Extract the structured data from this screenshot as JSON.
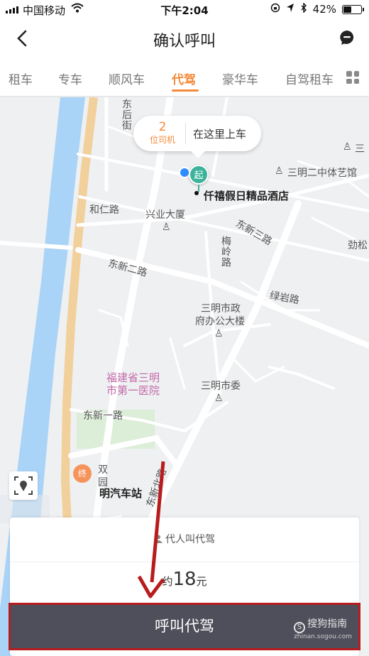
{
  "status_bar": {
    "carrier": "中国移动",
    "time": "下午2:04",
    "battery": "42%"
  },
  "nav": {
    "title": "确认呼叫"
  },
  "tabs": [
    "租车",
    "专车",
    "顺风车",
    "代驾",
    "豪华车",
    "自驾租车"
  ],
  "active_tab": "代驾",
  "map": {
    "bubble": {
      "driver_count": "2",
      "driver_unit": "位司机",
      "pickup_text": "在这里上车"
    },
    "start_label": "起",
    "end_label": "终",
    "labels": {
      "hotel": "仟禧假日精品酒店",
      "east_back_street": "东后街",
      "museum": "三明二中体艺馆",
      "heren_road": "和仁路",
      "xingye": "兴业大厦",
      "dongxin3": "东新三路",
      "meiling": "梅岭路",
      "jinsong": "劲松",
      "dongxin2": "东新二路",
      "lvyan": "绿岩路",
      "gov1": "三明市政",
      "gov2": "府办公大楼",
      "hospital1": "福建省三明",
      "hospital2": "市第一医院",
      "committee": "三明市委",
      "dongxin1": "东新一路",
      "shuangyuan1": "双",
      "shuangyuan2": "园",
      "bus_station": "明汽车站",
      "north_road": "东新北路",
      "san": "三"
    }
  },
  "card": {
    "proxy_text": "代人叫代驾",
    "price_prefix": "约",
    "price_amount": "18",
    "price_unit": "元",
    "call_button": "呼叫代驾"
  },
  "watermark": {
    "name": "搜狗指南",
    "url": "zhinan.sogou.com"
  },
  "colors": {
    "accent": "#f58a3a",
    "button": "#4e4f5a",
    "highlight": "#b81c1c",
    "start_pin": "#3cb39a",
    "river": "#a9d3f7"
  }
}
